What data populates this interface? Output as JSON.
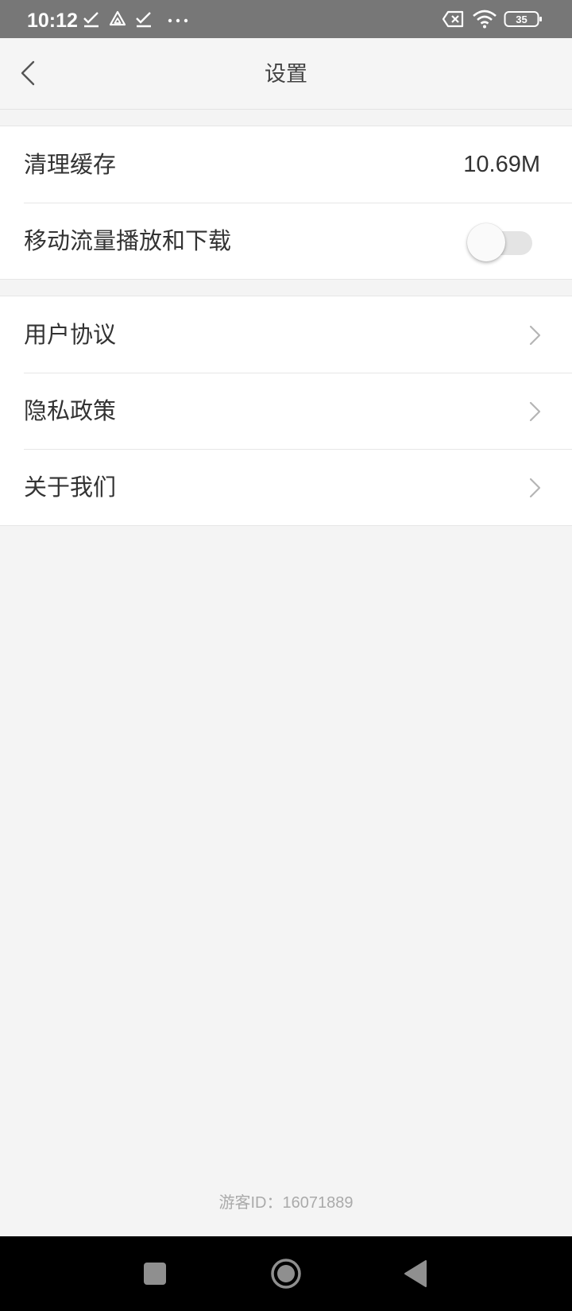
{
  "status_bar": {
    "time": "10:12",
    "battery": "35",
    "icons": [
      "check-icon",
      "drive-icon",
      "check-icon",
      "more-dots-icon",
      "sim-error-icon",
      "wifi-icon",
      "battery-icon"
    ]
  },
  "header": {
    "title": "设置",
    "back_icon": "back-chevron-icon"
  },
  "settings": {
    "clear_cache": {
      "label": "清理缓存",
      "value": "10.69M"
    },
    "mobile_data": {
      "label": "移动流量播放和下载",
      "enabled": false
    },
    "user_agreement": {
      "label": "用户协议"
    },
    "privacy_policy": {
      "label": "隐私政策"
    },
    "about_us": {
      "label": "关于我们"
    }
  },
  "footer": {
    "visitor_id": "游客ID：16071889"
  },
  "nav_bar": {
    "icons": [
      "recents-square-icon",
      "home-circle-icon",
      "back-triangle-icon"
    ]
  },
  "colors": {
    "status_bar_bg": "#777777",
    "page_bg": "#f4f4f4",
    "card_bg": "#ffffff",
    "text_primary": "#333333",
    "text_muted": "#aaaaaa",
    "divider": "#e6e6e6",
    "nav_bar_bg": "#000000"
  }
}
